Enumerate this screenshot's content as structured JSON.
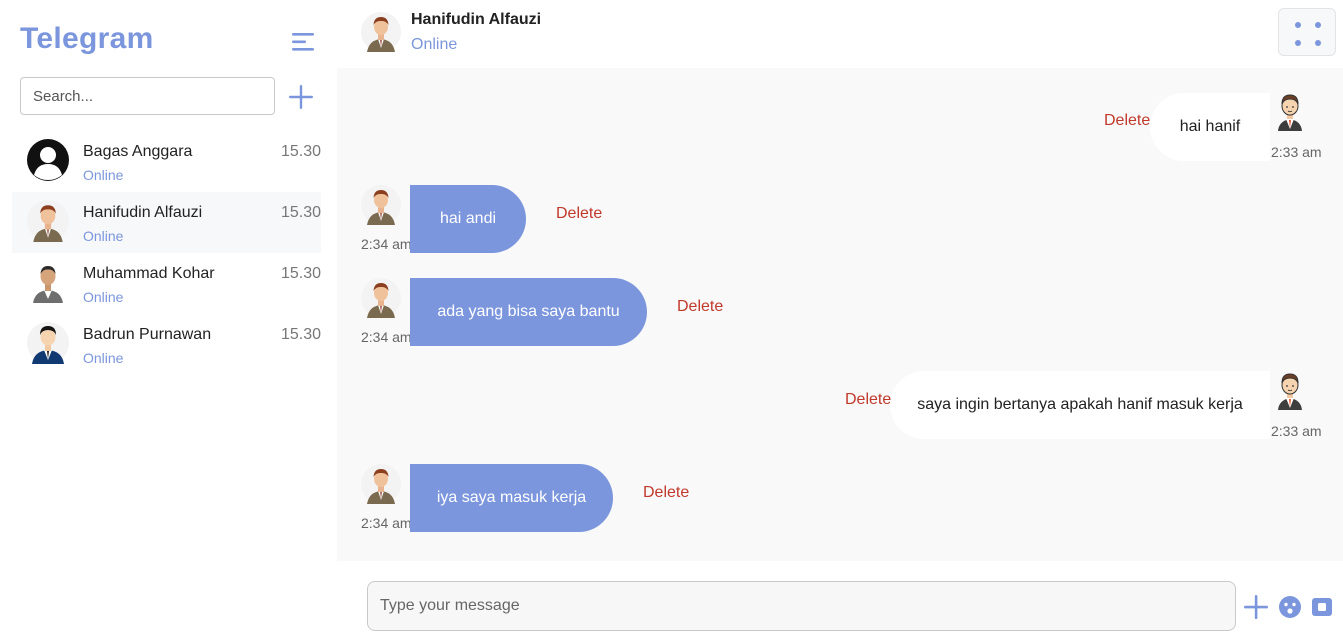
{
  "app": {
    "title": "Telegram"
  },
  "colors": {
    "accent": "#7b96dc",
    "danger": "#c0392b",
    "chat_bg": "#f9f9f9"
  },
  "sidebar": {
    "search_placeholder": "Search...",
    "menu_icon": "hamburger-menu-icon",
    "add_icon": "plus-icon",
    "contacts": [
      {
        "name": "Bagas Anggara",
        "status": "Online",
        "time": "15.30",
        "avatar": "default-user-icon"
      },
      {
        "name": "Hanifudin Alfauzi",
        "status": "Online",
        "time": "15.30",
        "avatar": "man-suit-avatar",
        "active": true
      },
      {
        "name": "Muhammad Kohar",
        "status": "Online",
        "time": "15.30",
        "avatar": "man-avatar"
      },
      {
        "name": "Badrun Purnawan",
        "status": "Online",
        "time": "15.30",
        "avatar": "man-blue-suit-avatar"
      }
    ]
  },
  "header": {
    "name": "Hanifudin Alfauzi",
    "status": "Online",
    "more_icon": "four-dots-icon"
  },
  "messages": [
    {
      "side": "out",
      "text": "hai hanif",
      "time": "2:33 am",
      "delete": "Delete"
    },
    {
      "side": "in",
      "text": "hai andi",
      "time": "2:34 am",
      "delete": "Delete"
    },
    {
      "side": "in",
      "text": "ada yang bisa saya bantu",
      "time": "2:34 am",
      "delete": "Delete"
    },
    {
      "side": "out",
      "text": "saya ingin bertanya apakah hanif masuk kerja",
      "time": "2:33 am",
      "delete": "Delete"
    },
    {
      "side": "in",
      "text": "iya saya masuk kerja",
      "time": "2:34 am",
      "delete": "Delete"
    }
  ],
  "composer": {
    "placeholder": "Type your message",
    "icons": [
      "plus-icon",
      "emoji-icon",
      "camera-icon"
    ]
  }
}
